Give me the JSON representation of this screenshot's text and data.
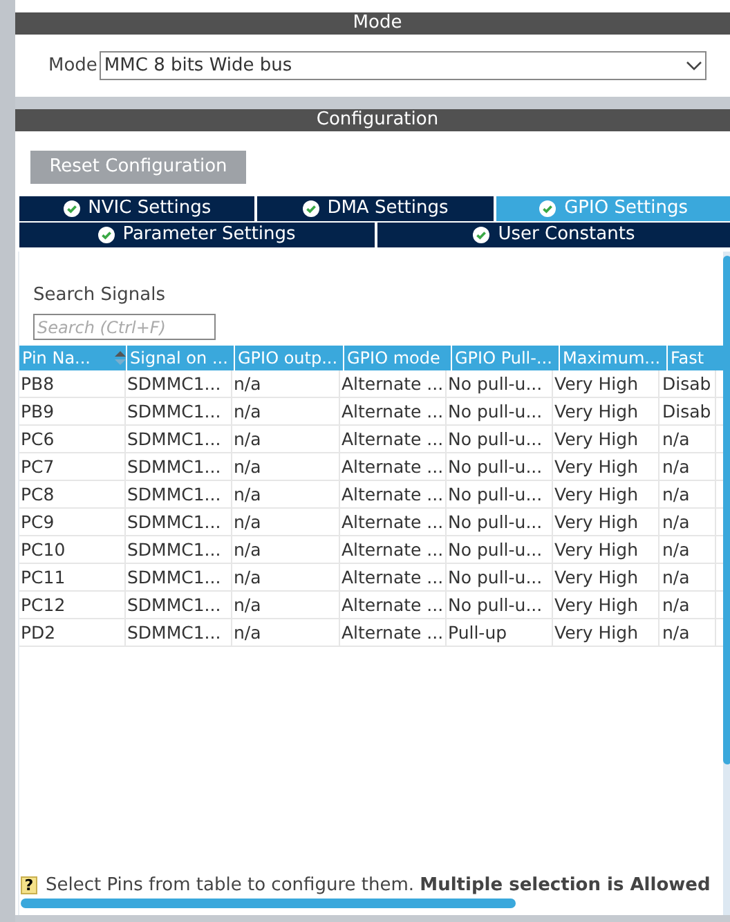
{
  "mode_section": {
    "title": "Mode",
    "field_label": "Mode",
    "value": "MMC 8 bits Wide bus"
  },
  "configuration": {
    "title": "Configuration",
    "reset_button": "Reset Configuration",
    "tab_rows": [
      [
        {
          "label": "NVIC Settings",
          "selected": false
        },
        {
          "label": "DMA Settings",
          "selected": false
        },
        {
          "label": "GPIO Settings",
          "selected": true
        }
      ],
      [
        {
          "label": "Parameter Settings",
          "selected": false
        },
        {
          "label": "User Constants",
          "selected": false
        }
      ]
    ],
    "search": {
      "label": "Search Signals",
      "placeholder": "Search (Ctrl+F)"
    },
    "table": {
      "columns": [
        "Pin Na...",
        "Signal on ...",
        "GPIO outp...",
        "GPIO mode",
        "GPIO Pull-...",
        "Maximum...",
        "Fast"
      ],
      "rows": [
        [
          "PB8",
          "SDMMC1...",
          "n/a",
          "Alternate ...",
          "No pull-u...",
          "Very High",
          "Disab"
        ],
        [
          "PB9",
          "SDMMC1...",
          "n/a",
          "Alternate ...",
          "No pull-u...",
          "Very High",
          "Disab"
        ],
        [
          "PC6",
          "SDMMC1...",
          "n/a",
          "Alternate ...",
          "No pull-u...",
          "Very High",
          "n/a"
        ],
        [
          "PC7",
          "SDMMC1...",
          "n/a",
          "Alternate ...",
          "No pull-u...",
          "Very High",
          "n/a"
        ],
        [
          "PC8",
          "SDMMC1...",
          "n/a",
          "Alternate ...",
          "No pull-u...",
          "Very High",
          "n/a"
        ],
        [
          "PC9",
          "SDMMC1...",
          "n/a",
          "Alternate ...",
          "No pull-u...",
          "Very High",
          "n/a"
        ],
        [
          "PC10",
          "SDMMC1...",
          "n/a",
          "Alternate ...",
          "No pull-u...",
          "Very High",
          "n/a"
        ],
        [
          "PC11",
          "SDMMC1...",
          "n/a",
          "Alternate ...",
          "No pull-u...",
          "Very High",
          "n/a"
        ],
        [
          "PC12",
          "SDMMC1...",
          "n/a",
          "Alternate ...",
          "No pull-u...",
          "Very High",
          "n/a"
        ],
        [
          "PD2",
          "SDMMC1...",
          "n/a",
          "Alternate ...",
          "Pull-up",
          "Very High",
          "n/a"
        ]
      ]
    },
    "footer": {
      "help_icon": "?",
      "text": "Select Pins from table to configure them. **Multiple selection is Allowed**"
    }
  }
}
